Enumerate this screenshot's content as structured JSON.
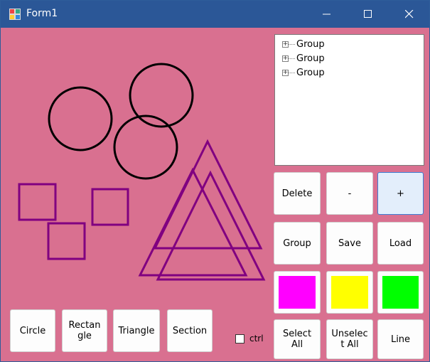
{
  "window": {
    "title": "Form1"
  },
  "tree": {
    "items": [
      "Group",
      "Group",
      "Group"
    ]
  },
  "buttons": {
    "delete": "Delete",
    "minus": "-",
    "plus": "+",
    "group": "Group",
    "save": "Save",
    "load": "Load",
    "select_all": "Select All",
    "unselect_all": "Unselect All",
    "line": "Line",
    "circle": "Circle",
    "rectangle": "Rectangle",
    "triangle": "Triangle",
    "section": "Section"
  },
  "checkbox": {
    "label": "ctrl"
  },
  "colors": {
    "background": "#d97090",
    "magenta": "#ff00ff",
    "yellow": "#ffff00",
    "green": "#00ff00",
    "circle_stroke": "#000000",
    "shape_stroke": "#800080"
  }
}
